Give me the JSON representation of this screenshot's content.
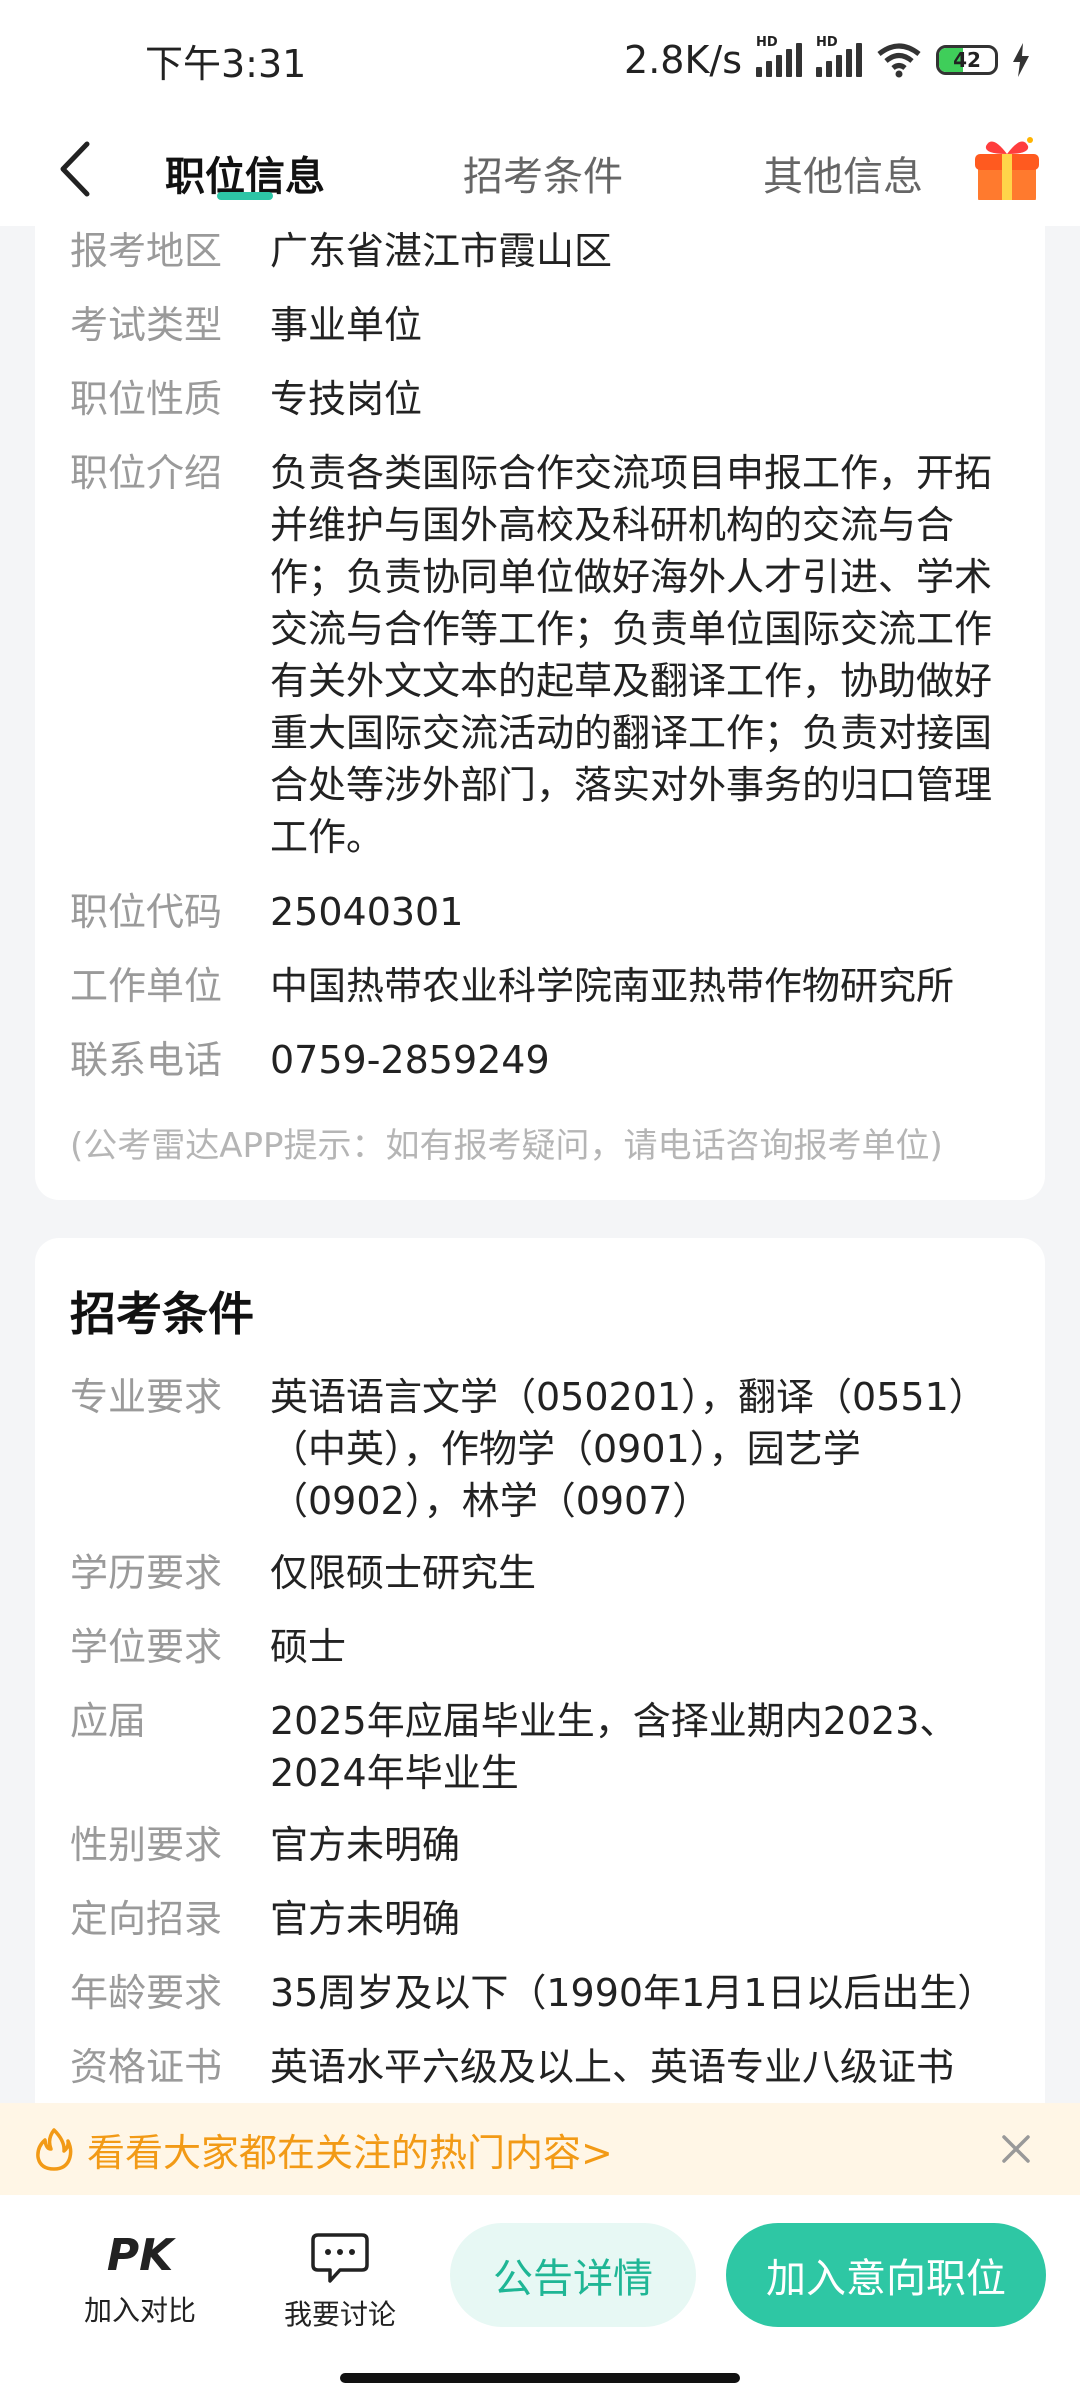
{
  "status_bar": {
    "time": "下午3:31",
    "network_speed": "2.8K/s",
    "battery": "42"
  },
  "nav": {
    "tabs": [
      {
        "label": "职位信息",
        "active": true
      },
      {
        "label": "招考条件",
        "active": false
      },
      {
        "label": "其他信息",
        "active": false
      }
    ],
    "accent_color": "#2dc5a6"
  },
  "position_info": {
    "rows": [
      {
        "label": "报考地区",
        "value": "广东省湛江市霞山区"
      },
      {
        "label": "考试类型",
        "value": "事业单位"
      },
      {
        "label": "职位性质",
        "value": "专技岗位"
      },
      {
        "label": "职位介绍",
        "value_lines": [
          "负责各类国际合作交流项目申报工作，开拓",
          "并维护与国外高校及科研机构的交流与合",
          "作；负责协同单位做好海外人才引进、学术",
          "交流与合作等工作；负责单位国际交流工作",
          "有关外文文本的起草及翻译工作，协助做好",
          "重大国际交流活动的翻译工作；负责对接国",
          "合处等涉外部门，落实对外事务的归口管理",
          "工作。"
        ]
      },
      {
        "label": "职位代码",
        "value": "25040301"
      },
      {
        "label": "工作单位",
        "value": "中国热带农业科学院南亚热带作物研究所"
      },
      {
        "label": "联系电话",
        "value": "0759-2859249"
      }
    ],
    "hint": "(公考雷达APP提示：如有报考疑问，请电话咨询报考单位)"
  },
  "conditions": {
    "title": "招考条件",
    "rows": [
      {
        "label": "专业要求",
        "value_lines": [
          "英语语言文学（050201），翻译（0551）",
          "（中英），作物学（0901），园艺学",
          "（0902），林学（0907）"
        ]
      },
      {
        "label": "学历要求",
        "value": "仅限硕士研究生"
      },
      {
        "label": "学位要求",
        "value": "硕士"
      },
      {
        "label": "应届",
        "value_lines": [
          "2025年应届毕业生，含择业期内2023、",
          "2024年毕业生"
        ]
      },
      {
        "label": "性别要求",
        "value": "官方未明确"
      },
      {
        "label": "定向招录",
        "value": "官方未明确"
      },
      {
        "label": "年龄要求",
        "value": "35周岁及以下（1990年1月1日以后出生）"
      },
      {
        "label": "资格证书",
        "value": "英语水平六级及以上、英语专业八级证书"
      }
    ]
  },
  "banner": {
    "text": "看看大家都在关注的热门内容>"
  },
  "bottom_bar": {
    "compare_icon": "PK",
    "compare_label": "加入对比",
    "discuss_label": "我要讨论",
    "notice_button": "公告详情",
    "add_button": "加入意向职位"
  }
}
